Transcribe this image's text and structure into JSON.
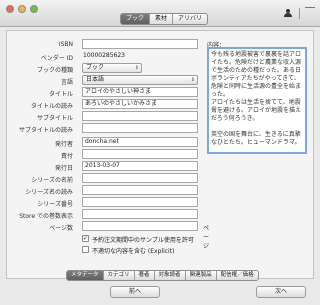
{
  "toolbar": {
    "tabs": [
      {
        "label": "ブック",
        "active": true
      },
      {
        "label": "素材",
        "active": false
      },
      {
        "label": "アリバリ",
        "active": false
      }
    ]
  },
  "form": {
    "isbn": {
      "label": "ISBN",
      "value": ""
    },
    "vendor_id": {
      "label": "ベンダー ID",
      "value": "10000285623"
    },
    "book_type": {
      "label": "ブックの種類",
      "value": "ブック"
    },
    "language": {
      "label": "言語",
      "value": "日本語"
    },
    "title": {
      "label": "タイトル",
      "value": "アロイのやさしい神さま"
    },
    "title_reading": {
      "label": "タイトルの読み",
      "value": "あろいのやさしいかみさま"
    },
    "subtitle": {
      "label": "サブタイトル",
      "value": ""
    },
    "subtitle_reading": {
      "label": "サブタイトルの読み",
      "value": ""
    },
    "publisher": {
      "label": "発行者",
      "value": "doncha.net"
    },
    "price": {
      "label": "責付",
      "value": ""
    },
    "publish_date": {
      "label": "発行日",
      "value": "2013-03-07"
    },
    "series_name": {
      "label": "シリーズの名前",
      "value": ""
    },
    "series_reading": {
      "label": "シリーズ名の読み",
      "value": ""
    },
    "series_number": {
      "label": "シリーズ番号",
      "value": ""
    },
    "store_volume": {
      "label": "Store での巻数表示",
      "value": ""
    },
    "page_count": {
      "label": "ページ数",
      "value": "",
      "suffix": "ページ"
    },
    "sample_check": {
      "label": "予約注文期間中のサンプル使用を許可",
      "checked": true
    },
    "explicit_check": {
      "label": "不適切な内容を含む (Explicit)",
      "checked": false
    }
  },
  "description": {
    "label": "内容：",
    "text": "今も残る地震被害で裏裏を話アロイたち。危険だけど農業な収入源で生活のための種だった。ある日ボランティアたちがやってきて、危険と同時に生活源の豊全を始まった。\nアロイたちは生活を捨てて、地震脅を避ける。アロイが地震を描えだろう何ろうき。\n\n英空の国を舞台に、生きるに真摯なひとたち。ヒューマンドラマ。"
  },
  "bottom_tabs": [
    {
      "label": "メタデータ",
      "active": true
    },
    {
      "label": "カテゴリ",
      "active": false
    },
    {
      "label": "著者",
      "active": false
    },
    {
      "label": "対象読者",
      "active": false
    },
    {
      "label": "関連製品",
      "active": false
    },
    {
      "label": "配信権／価格",
      "active": false
    }
  ],
  "buttons": {
    "prev": "前へ",
    "next": "次へ"
  }
}
